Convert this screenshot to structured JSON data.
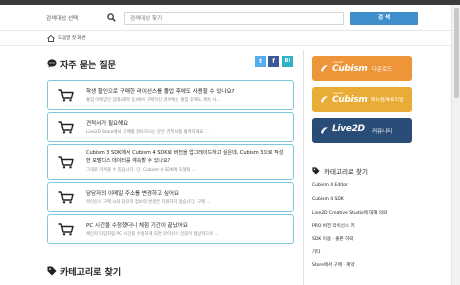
{
  "search": {
    "select_label": "검색대상 선택",
    "placeholder": "검색대상 찾기",
    "button_label": "검 색"
  },
  "breadcrumb": {
    "home_label": "도움말 첫 화면"
  },
  "faq": {
    "title": "자주 묻는 질문",
    "share": {
      "twitter": "t",
      "facebook": "f",
      "blog": "B!"
    },
    "items": [
      {
        "question": "학생 할인으로 구매한 라이선스를 졸업 후에도 사용할 수 있나요?",
        "answer": "졸업 이에앙민 상태(재학 등)에서 구매하신 경우에는 졸업 후에도 계속 사..."
      },
      {
        "question": "견적서가 필요해요",
        "answer": "Live2D Store에서 구매를 검토하시는 분은 견적서를 출력하세요 ..."
      },
      {
        "question": "Cubism 3 SDK에서 Cubism 4 SDK로 버전을 업그레이드하고 싶은데, Cubism 3으로 작성",
        "question_2": "한 모델디스 데이터를 계속할 수 있나요?",
        "answer": "그대로 가져올 수 있습니다. 단, Cubism 4 SDK에 모델의 ..."
      },
      {
        "question": "담당자의 이메일 주소를 변경하고 싶어요",
        "answer": "라이선스 구매 시의 담당자 정보의 변경은 지원하지 않습니다. 구매 ..."
      },
      {
        "question": "PC 시간을 수정했더니 체험 기간이 끝났어요",
        "answer": "체인저 타임처럼 PC 시간을 수정하게 되면 라이선스 인증이 정상적으로 ..."
      }
    ]
  },
  "categories": {
    "title": "카테고리로 찾기"
  },
  "sidebar": {
    "download": {
      "brand_small": "Live2D",
      "brand": "Cubism",
      "label": "다운로드"
    },
    "manual": {
      "brand_small": "Live2D",
      "brand": "Cubism",
      "label": "매뉴얼/튜토리얼"
    },
    "community": {
      "brand": "Live2D",
      "label": "커뮤니티"
    },
    "category_title": "카테고리로 찾기",
    "category_items": [
      "Cubism 4 Editor",
      "Cubism 4 SDK",
      "Live2D Creative Studio에 대해 의뢰",
      "PRO 버전 라이선스 키",
      "SDK 이용 · 출판 허락",
      "기타",
      "Store에서 구매 · 계약"
    ]
  },
  "colors": {
    "accent": "#3e8fcc",
    "card_border": "#7ec8dc",
    "download": "#ef9539",
    "manual": "#e9ad37",
    "community": "#2a4d78"
  },
  "icons": {
    "search": "search-icon",
    "home": "home-icon",
    "faq": "speech-bubble-icon",
    "cart": "shopping-cart-icon",
    "tag": "tag-icon"
  }
}
